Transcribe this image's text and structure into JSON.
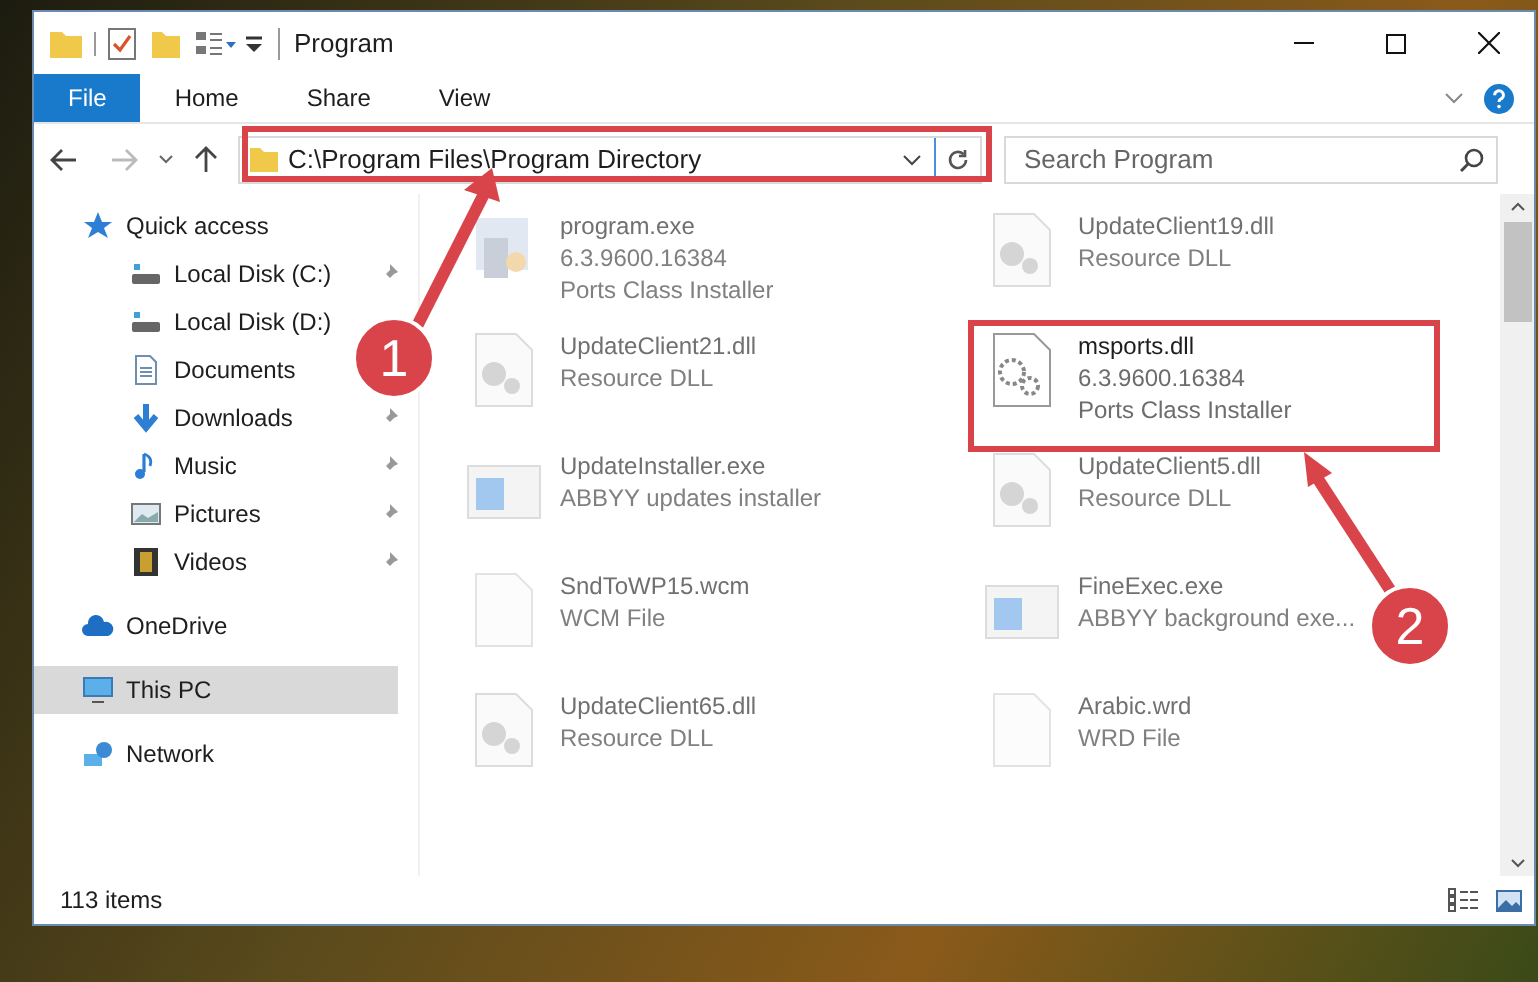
{
  "window": {
    "title": "Program"
  },
  "ribbon_tabs": [
    {
      "label": "File",
      "selected": true
    },
    {
      "label": "Home",
      "selected": false
    },
    {
      "label": "Share",
      "selected": false
    },
    {
      "label": "View",
      "selected": false
    }
  ],
  "address": {
    "value": "C:\\Program Files\\Program Directory"
  },
  "search": {
    "placeholder": "Search Program"
  },
  "navigation": [
    {
      "label": "Quick access",
      "kind": "star",
      "selected": false,
      "children": [
        {
          "label": "Local Disk (C:)",
          "kind": "drive",
          "pinned": true,
          "selected": false
        },
        {
          "label": "Local Disk (D:)",
          "kind": "drive",
          "pinned": false,
          "selected": false
        },
        {
          "label": "Documents",
          "kind": "document",
          "pinned": false,
          "selected": false
        },
        {
          "label": "Downloads",
          "kind": "download",
          "pinned": true,
          "selected": false
        },
        {
          "label": "Music",
          "kind": "music",
          "pinned": true,
          "selected": false
        },
        {
          "label": "Pictures",
          "kind": "picture",
          "pinned": true,
          "selected": false
        },
        {
          "label": "Videos",
          "kind": "video",
          "pinned": true,
          "selected": false
        }
      ]
    },
    {
      "label": "OneDrive",
      "kind": "cloud",
      "selected": false
    },
    {
      "label": "This PC",
      "kind": "monitor",
      "selected": true
    },
    {
      "label": "Network",
      "kind": "network",
      "selected": false
    }
  ],
  "files": [
    {
      "name": "program.exe",
      "details": [
        "6.3.9600.16384",
        "Ports Class Installer"
      ],
      "kind": "installer",
      "dimmed": true
    },
    {
      "name": "UpdateClient19.dll",
      "details": [
        "Resource DLL"
      ],
      "kind": "dll",
      "dimmed": true
    },
    {
      "name": "UpdateClient21.dll",
      "details": [
        "Resource DLL"
      ],
      "kind": "dll",
      "dimmed": true
    },
    {
      "name": "msports.dll",
      "details": [
        "6.3.9600.16384",
        "Ports Class Installer"
      ],
      "kind": "gears",
      "dimmed": false
    },
    {
      "name": "UpdateInstaller.exe",
      "details": [
        "ABBYY updates installer"
      ],
      "kind": "app",
      "dimmed": true
    },
    {
      "name": "UpdateClient5.dll",
      "details": [
        "Resource DLL"
      ],
      "kind": "dll",
      "dimmed": true
    },
    {
      "name": "SndToWP15.wcm",
      "details": [
        "WCM File"
      ],
      "kind": "file",
      "dimmed": true
    },
    {
      "name": "FineExec.exe",
      "details": [
        "ABBYY background exe..."
      ],
      "kind": "app",
      "dimmed": true
    },
    {
      "name": "UpdateClient65.dll",
      "details": [
        "Resource DLL"
      ],
      "kind": "dll",
      "dimmed": true
    },
    {
      "name": "Arabic.wrd",
      "details": [
        "WRD File"
      ],
      "kind": "file",
      "dimmed": true
    }
  ],
  "status_bar": {
    "item_count": "113 items"
  },
  "callouts": [
    {
      "label": "1"
    },
    {
      "label": "2"
    }
  ]
}
